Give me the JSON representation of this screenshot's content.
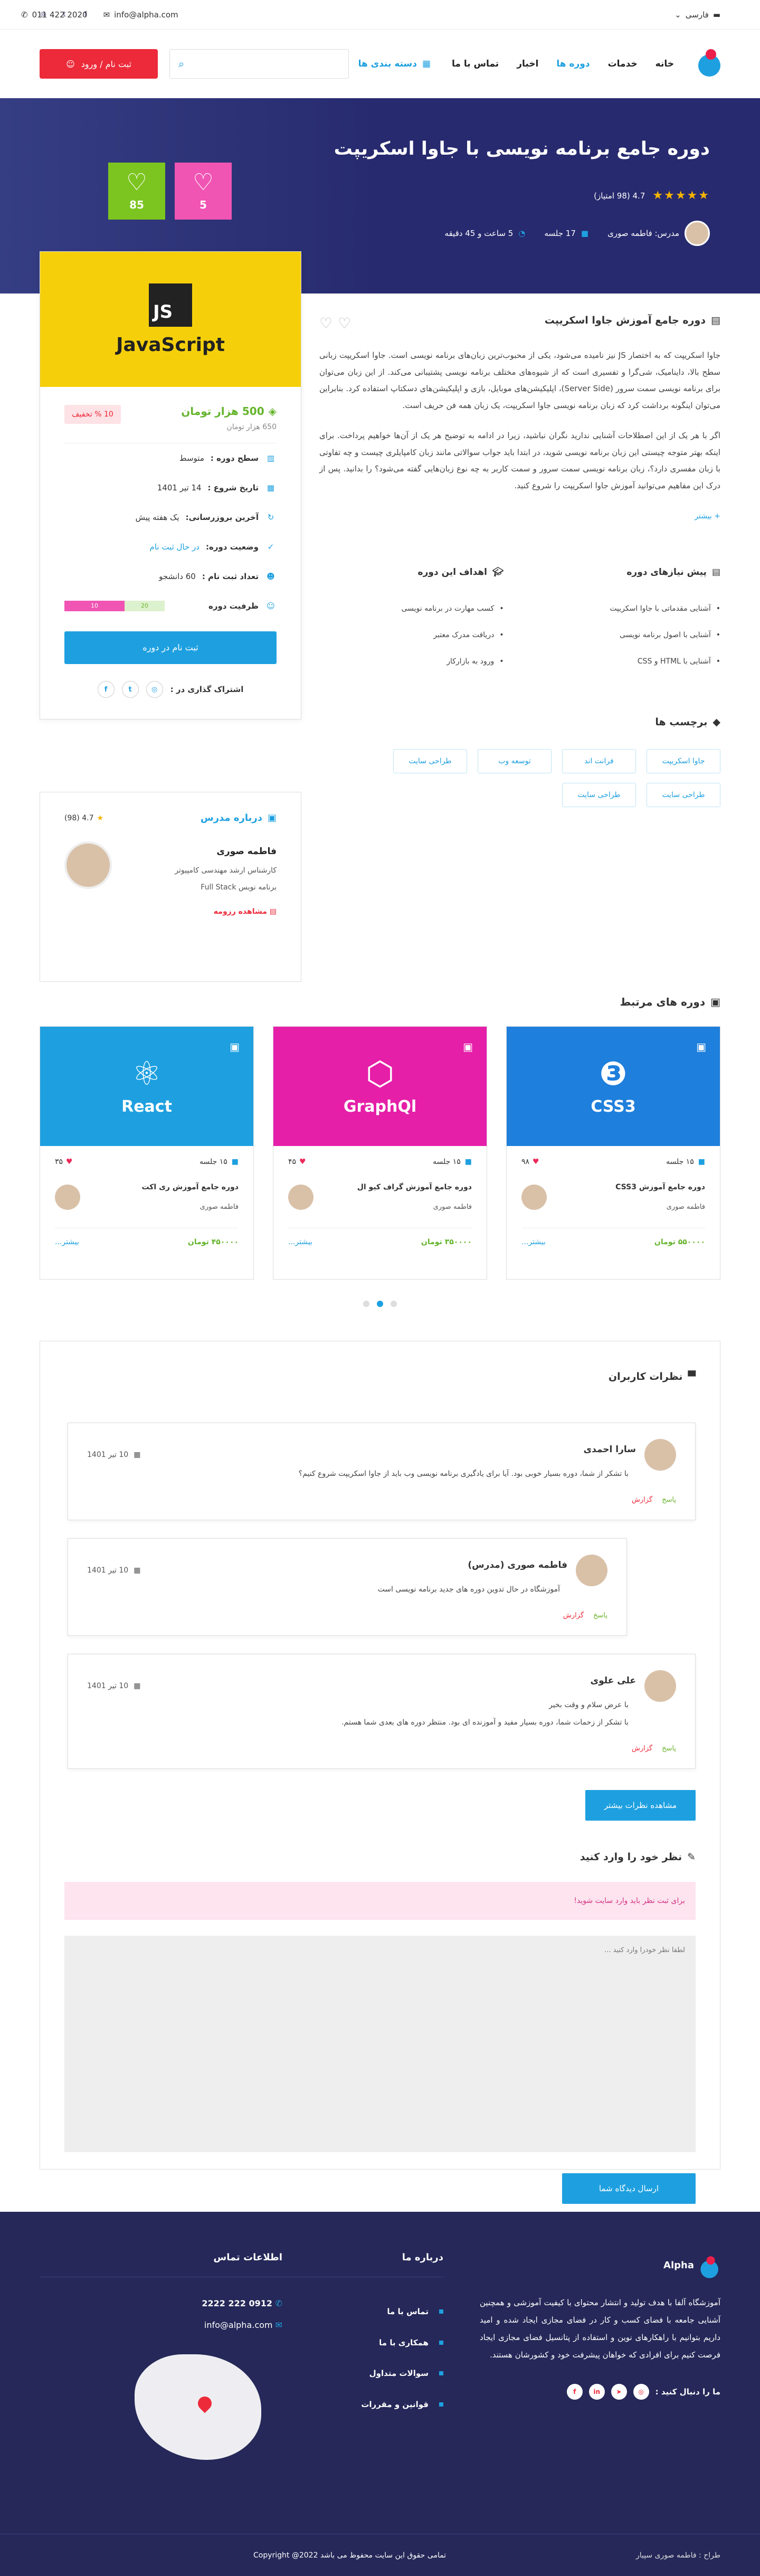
{
  "topbar": {
    "phone": "011 422 2020",
    "email": "info@alpha.com",
    "language": "فارسی",
    "social": [
      "instagram-icon",
      "twitter-icon",
      "facebook-icon"
    ]
  },
  "header": {
    "nav": [
      "خانه",
      "خدمات",
      "دوره ها",
      "اخبار",
      "تماس با ما"
    ],
    "nav_active": "دوره ها",
    "categories": "دسته بندی ها",
    "search_placeholder": "",
    "login": "ثبت نام / ورود"
  },
  "hero": {
    "title": "دوره جامع برنامه نویسی با جاوا اسکریپت",
    "rating_text": "4.7 (98 امتیاز)",
    "teacher": "مدرس: فاطمه صوری",
    "sessions": "17 جلسه",
    "duration": "5 ساعت و 45 دقیقه",
    "likes": "85",
    "dislikes": "5"
  },
  "sidecard": {
    "cover_title": "JavaScript",
    "cover_badge": "JS",
    "price": "500 هزار تومان",
    "old_price": "650 هزار تومان",
    "discount": "10 % تخفیف",
    "items": [
      {
        "key": "سطح دوره :",
        "val": "متوسط"
      },
      {
        "key": "تاریخ شروع :",
        "val": "14 تیر 1401"
      },
      {
        "key": "آخرین بروزرسانی:",
        "val": "یک هفته پیش"
      },
      {
        "key": "وضعیت دوره:",
        "val": "در حال ثبت نام"
      },
      {
        "key": "تعداد ثبت نام :",
        "val": "60 دانشجو"
      },
      {
        "key": "ظرفیت دوره",
        "val": ""
      }
    ],
    "capacity_total": "20",
    "capacity_used": "10",
    "enroll": "ثبت نام در دوره",
    "share": "اشتراک گذاری در :"
  },
  "teacher": {
    "title": "درباره مدرس",
    "rating": "4.7 (98)",
    "name": "فاطمه صوری",
    "line1": "کارشناس ارشد مهندسی کامپیوتر",
    "line2": "برنامه نویس Full Stack",
    "resume": "مشاهده رزومه"
  },
  "content": {
    "title": "دوره جامع آموزش جاوا اسکریپت",
    "p1": "جاوا اسکریپت که به اختصار JS نیز نامیده می‌شود، یکی از محبوب‌ترین زبان‌های برنامه نویسی است. جاوا اسکریپت زبانی سطح بالا، داینامیک، شی‌گرا و تفسیری است که از شیوه‌های مختلف برنامه نویسی پشتیبانی می‌کند. از این زبان می‌توان برای برنامه نویسی سمت سرور (Server Side)، اپلیکیشن‌های موبایل، بازی و اپلیکیشن‌های دسکتاپ استفاده کرد. بنابراین می‌توان اینگونه برداشت کرد که زبان برنامه نویسی جاوا اسکریپت، یک زبان همه فن حریف است.",
    "p2": "اگر با هر یک از این اصطلاحات آشنایی ندارید نگران نباشید، زیرا در ادامه به توضیح هر یک از آن‌ها خواهیم پرداخت. برای اینکه بهتر متوجه چیستی این زبان برنامه نویسی شوید، در ابتدا باید جواب سوالاتی مانند زبان کامپایلری چیست و چه تفاوتی با زبان مفسری دارد؟، زبان برنامه نویسی سمت سرور و سمت کاربر به چه نوع زبان‌هایی گفته می‌شود؟ را بدانید. پس از درک این مفاهیم می‌توانید آموزش جاوا اسکریپت را شروع کنید.",
    "more": "بیشتر",
    "prereq_title": "پیش نیازهای دوره",
    "prereq": [
      "آشنایی مقدماتی با جاوا اسکریپت",
      "آشنایی با اصول برنامه نویسی",
      "آشنایی با HTML و CSS"
    ],
    "goals_title": "اهداف این دوره",
    "goals": [
      "کسب مهارت در برنامه نویسی",
      "دریافت مدرک معتبر",
      "ورود به بازارکار"
    ],
    "tags_title": "برچسب ها",
    "tags": [
      "جاوا اسکریپت",
      "فرانت اند",
      "توسعه وب",
      "طراحی سایت",
      "طراحی سایت",
      "طراحی سایت"
    ]
  },
  "related": {
    "title": "دوره های مرتبط",
    "cards": [
      {
        "cover": "CSS3",
        "glyph": "❸",
        "likes": "۹۸",
        "sessions": "۱۵ جلسه",
        "title": "دوره جامع آموزش CSS3",
        "teacher": "فاطمه صوری",
        "price": "۵۵۰۰۰۰ تومان",
        "more": "بیشتر..."
      },
      {
        "cover": "GraphQl",
        "glyph": "⬡",
        "likes": "۴۵",
        "sessions": "۱۵ جلسه",
        "title": "دوره جامع آموزش گراف کیو ال",
        "teacher": "فاطمه صوری",
        "price": "۳۵۰۰۰۰ تومان",
        "more": "بیشتر..."
      },
      {
        "cover": "React",
        "glyph": "⚛",
        "likes": "۳۵",
        "sessions": "۱۵ جلسه",
        "title": "دوره جامع آموزش ری اکت",
        "teacher": "فاطمه صوری",
        "price": "۴۵۰۰۰۰ تومان",
        "more": "بیشتر..."
      }
    ],
    "colors": [
      "#1e7fdc",
      "#e51fa8",
      "#1ea0e0"
    ]
  },
  "comments": {
    "title": "نظرات کاربران",
    "items": [
      {
        "name": "سارا احمدی",
        "date": "10 تیر 1401",
        "text": "با تشکر از شما، دوره بسیار خوبی بود. آیا برای یادگیری برنامه نویسی وب باید از جاوا اسکریپت شروع کنیم؟",
        "reply": "پاسخ",
        "report": "گزارش"
      },
      {
        "name": "فاطمه صوری (مدرس)",
        "date": "10 تیر 1401",
        "text": "آموزشگاه در حال تدوین دوره های جدید برنامه نویسی است",
        "reply": "پاسخ",
        "report": "گزارش"
      },
      {
        "name": "علی علوی",
        "date": "10 تیر 1401",
        "text": "با عرض سلام و وقت بخیر\nبا تشکر از زحمات شما، دوره بسیار مفید و آموزنده ای بود. منتظر دوره های بعدی شما هستم.",
        "reply": "پاسخ",
        "report": "گزارش"
      }
    ],
    "more_btn": "مشاهده نظرات بیشتر",
    "form_title": "نظر خود را وارد کنید",
    "notice": "برای ثبت نظر باید وارد سایت شوید!",
    "placeholder": "لطفا نظر خودرا وارد کنید ...",
    "submit": "ارسال دیدگاه شما"
  },
  "footer": {
    "brand": "Alpha",
    "about": "آموزشگاه آلفا با هدف تولید و انتشار محتوای با کیفیت آموزشی و همچنین آشنایی جامعه با فضای کسب و کار در فضای مجازی ایجاد شده و امید داریم بتوانیم با راهکارهای نوین و استفاده از پتانسیل فضای مجازی ایجاد فرصت کنیم برای افرادی که خواهان پیشرفت خود و کشورشان هستند.",
    "follow": "ما را دنبال کنید :",
    "links_title": "درباره ما",
    "links": [
      "تماس با ما",
      "همکاری با ما",
      "سوالات متداول",
      "قوانین و مقررات"
    ],
    "contact_title": "اطلاعات تماس",
    "phone": "0912 222 2222",
    "email": "info@alpha.com",
    "copyright": "تمامی حقوق این سایت محفوظ می باشد Copyright @2022",
    "designer": "طراح : فاطمه صوری سپیار"
  }
}
